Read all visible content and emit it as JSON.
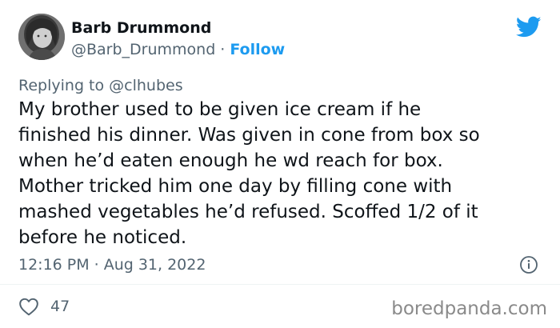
{
  "author": {
    "name": "Barb Drummond",
    "handle": "@Barb_Drummond",
    "separator": "·",
    "follow_label": "Follow"
  },
  "reply": {
    "text": "Replying to @clhubes"
  },
  "tweet": {
    "lines": [
      "My brother used to be given ice cream if he",
      "finished his dinner. Was given in cone from box so",
      "when he’d eaten enough he wd reach for box.",
      "Mother tricked him one day by filling cone with",
      "mashed vegetables he’d refused. Scoffed 1/2 of it",
      "before he noticed."
    ]
  },
  "meta": {
    "time": "12:16 PM",
    "separator": "·",
    "date": "Aug 31, 2022"
  },
  "engagement": {
    "likes": "47"
  },
  "watermark": {
    "text": "boredpanda.com"
  },
  "icons": {
    "brand": "twitter-bird-icon",
    "info": "info-icon",
    "like": "heart-icon"
  },
  "colors": {
    "accent": "#1d9bf0",
    "text": "#0f1419",
    "secondary": "#536471",
    "watermark": "#8a8a8a"
  }
}
